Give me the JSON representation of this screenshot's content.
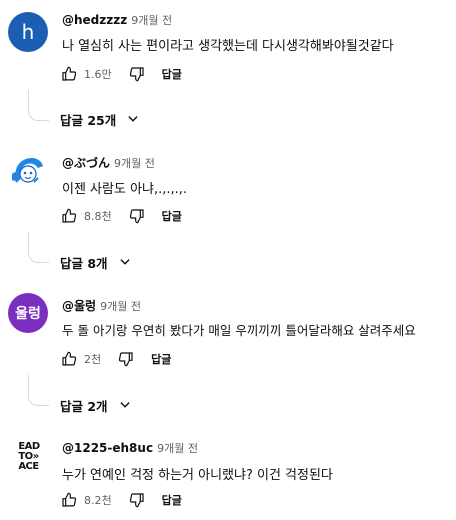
{
  "comments": [
    {
      "avatar_letter": "h",
      "avatar_color": "#1a5fb4",
      "author": "@hedzzzz",
      "time": "9개월 전",
      "text": "나 열심히 사는 편이라고 생각했는데 다시생각해봐야될것같다",
      "likes": "1.6만",
      "reply_label": "답글",
      "replies_label": "답글 25개"
    },
    {
      "avatar_icon": "cartoon-avatar-icon",
      "author": "@ぶづん",
      "time": "9개월 전",
      "text": "이젠 사람도 아냐,.,.,.,.",
      "likes": "8.8천",
      "reply_label": "답글",
      "replies_label": "답글 8개"
    },
    {
      "avatar_letter": "울렁",
      "avatar_color": "#7b2fbf",
      "author": "@울렁",
      "time": "9개월 전",
      "text": "두 돌 아기랑 우연히 봤다가 매일 우끼끼끼 틀어달라해요 살려주세요",
      "likes": "2천",
      "reply_label": "답글",
      "replies_label": "답글 2개"
    },
    {
      "avatar_text": [
        "EAD",
        "TO»",
        "ACE"
      ],
      "author": "@1225-eh8uc",
      "time": "9개월 전",
      "text": "누가 연예인 걱정 하는거 아니랬냐? 이건 걱정된다",
      "likes": "8.2천",
      "reply_label": "답글"
    }
  ]
}
